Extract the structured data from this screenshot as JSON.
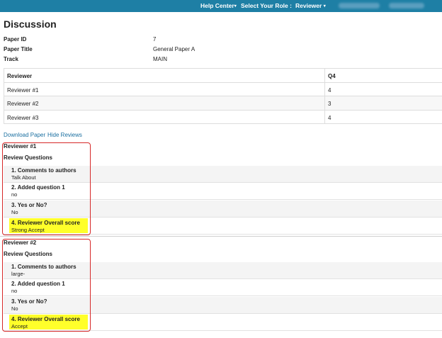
{
  "nav": {
    "help_center": "Help Center",
    "select_role_label": "Select Your Role :",
    "role": "Reviewer"
  },
  "page_title": "Discussion",
  "meta": {
    "paper_id_label": "Paper ID",
    "paper_id": "7",
    "paper_title_label": "Paper Title",
    "paper_title": "General Paper A",
    "track_label": "Track",
    "track": "MAIN"
  },
  "scores": {
    "headers": [
      "Reviewer",
      "Q4"
    ],
    "rows": [
      [
        "Reviewer #1",
        "4"
      ],
      [
        "Reviewer #2",
        "3"
      ],
      [
        "Reviewer #3",
        "4"
      ]
    ]
  },
  "links": {
    "download_paper": "Download Paper",
    "hide_reviews": "Hide Reviews"
  },
  "reviews": [
    {
      "title": "Reviewer #1",
      "subtitle": "Review Questions",
      "questions": [
        {
          "label": "1. Comments to authors",
          "value": "Talk About"
        },
        {
          "label": "2. Added question 1",
          "value": "no"
        },
        {
          "label": "3. Yes or No?",
          "value": "No"
        },
        {
          "label": "4. Reviewer Overall score",
          "value": "Strong Accept"
        }
      ]
    },
    {
      "title": "Reviewer #2",
      "subtitle": "Review Questions",
      "questions": [
        {
          "label": "1. Comments to authors",
          "value": "large-"
        },
        {
          "label": "2. Added question 1",
          "value": "no"
        },
        {
          "label": "3. Yes or No?",
          "value": "No"
        },
        {
          "label": "4. Reviewer Overall score",
          "value": "Accept"
        }
      ]
    }
  ],
  "colors": {
    "topbar": "#1e7fa5",
    "highlight": "#ffff2a",
    "annotation_box": "#d62828",
    "link": "#1a6fa0"
  }
}
